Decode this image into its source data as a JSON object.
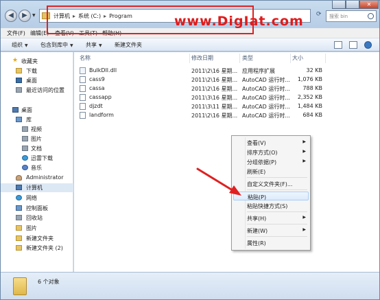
{
  "address": {
    "crumbs": [
      "计算机",
      "系统 (C:)",
      "Program",
      "..."
    ],
    "watermark": "www.DigIat.com",
    "search_placeholder": "搜索 bin"
  },
  "menubar": {
    "items": [
      "文件(F)",
      "编辑(E)",
      "查看(V)",
      "工具(T)",
      "帮助(H)"
    ]
  },
  "toolbar": {
    "organize": "组织",
    "include_library": "包含到库中",
    "share": "共享",
    "new_folder": "新建文件夹"
  },
  "sidebar": {
    "items": [
      {
        "label": "收藏夹",
        "icon": "star-icon"
      },
      {
        "label": "下载",
        "icon": "download-folder-icon"
      },
      {
        "label": "桌面",
        "icon": "desktop-icon"
      },
      {
        "label": "最近访问的位置",
        "icon": "recent-places-icon"
      },
      {
        "label": "桌面",
        "icon": "desktop-icon"
      },
      {
        "label": "库",
        "icon": "library-icon"
      },
      {
        "label": "视频",
        "icon": "video-library-icon"
      },
      {
        "label": "图片",
        "icon": "pictures-library-icon"
      },
      {
        "label": "文档",
        "icon": "documents-library-icon"
      },
      {
        "label": "迅雷下载",
        "icon": "thunder-download-icon"
      },
      {
        "label": "音乐",
        "icon": "music-library-icon"
      },
      {
        "label": "Administrator",
        "icon": "user-icon"
      },
      {
        "label": "计算机",
        "icon": "computer-icon"
      },
      {
        "label": "网络",
        "icon": "network-icon"
      },
      {
        "label": "控制面板",
        "icon": "control-panel-icon"
      },
      {
        "label": "回收站",
        "icon": "recycle-bin-icon"
      },
      {
        "label": "图片",
        "icon": "folder-icon"
      },
      {
        "label": "新建文件夹",
        "icon": "folder-icon"
      },
      {
        "label": "新建文件夹 (2)",
        "icon": "folder-icon"
      }
    ]
  },
  "columns": {
    "name": "名称",
    "date": "修改日期",
    "type": "类型",
    "size": "大小"
  },
  "files": [
    {
      "name": "BulkDll.dll",
      "date": "2011\\2\\16 星期...",
      "type": "应用程序扩展",
      "size": "32 KB"
    },
    {
      "name": "cass9",
      "date": "2011\\2\\16 星期...",
      "type": "AutoCAD 运行时...",
      "size": "1,076 KB"
    },
    {
      "name": "cassa",
      "date": "2011\\2\\16 星期...",
      "type": "AutoCAD 运行时...",
      "size": "788 KB"
    },
    {
      "name": "cassapp",
      "date": "2011\\3\\16 星期...",
      "type": "AutoCAD 运行时...",
      "size": "2,352 KB"
    },
    {
      "name": "djzdt",
      "date": "2011\\3\\11 星期...",
      "type": "AutoCAD 运行时...",
      "size": "1,484 KB"
    },
    {
      "name": "landform",
      "date": "2011\\2\\16 星期...",
      "type": "AutoCAD 运行时...",
      "size": "684 KB"
    }
  ],
  "context_menu": {
    "items": [
      {
        "label": "查看(V)",
        "submenu": true
      },
      {
        "label": "排序方式(O)",
        "submenu": true
      },
      {
        "label": "分组依据(P)",
        "submenu": true
      },
      {
        "label": "刷新(E)",
        "submenu": false
      },
      {
        "label": "自定义文件夹(F)...",
        "submenu": false
      },
      {
        "label": "粘贴(P)",
        "submenu": false,
        "highlight": true
      },
      {
        "label": "粘贴快捷方式(S)",
        "submenu": false
      },
      {
        "label": "共享(H)",
        "submenu": true
      },
      {
        "label": "新建(W)",
        "submenu": true
      },
      {
        "label": "属性(R)",
        "submenu": false
      }
    ]
  },
  "status": {
    "count": "6 个对象"
  },
  "colors": {
    "watermark": "#e11b1b",
    "annotation_red": "#e02020",
    "highlight": "#dcebfc"
  }
}
